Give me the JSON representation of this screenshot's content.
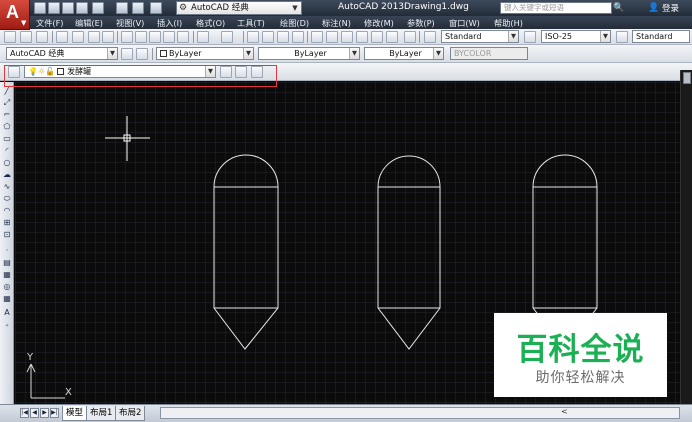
{
  "title_bar": {
    "workspace": "AutoCAD 经典",
    "app_title": "AutoCAD 2013",
    "file_name": "Drawing1.dwg",
    "search_placeholder": "键入关键字或短语",
    "login_label": "登录"
  },
  "menu": {
    "items": [
      "文件(F)",
      "编辑(E)",
      "视图(V)",
      "插入(I)",
      "格式(O)",
      "工具(T)",
      "绘图(D)",
      "标注(N)",
      "修改(M)",
      "参数(P)",
      "窗口(W)",
      "帮助(H)"
    ]
  },
  "styles_toolbar": {
    "text_style": "Standard",
    "dim_style": "ISO-25",
    "table_style": "Standard"
  },
  "layers_toolbar": {
    "workspace": "AutoCAD 经典",
    "color": "ByLayer",
    "linetype": "ByLayer",
    "lineweight": "ByLayer",
    "plotstyle": "BYCOLOR"
  },
  "layer_control": {
    "current_layer": "发酵罐"
  },
  "ucs": {
    "x_label": "X",
    "y_label": "Y"
  },
  "tabs": {
    "items": [
      "模型",
      "布局1",
      "布局2"
    ],
    "active": "模型"
  },
  "watermark": {
    "title": "百科全说",
    "subtitle": "助你轻松解决"
  },
  "colors": {
    "canvas": "#0b0b0b",
    "grid": "#2a2f36",
    "stroke": "#ffffff",
    "highlight": "#e0373b",
    "watermark_green": "#1bb053"
  }
}
